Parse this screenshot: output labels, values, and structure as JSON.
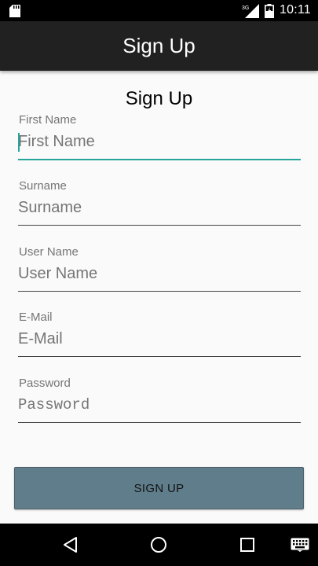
{
  "status_bar": {
    "network": "3G",
    "time": "10:11"
  },
  "app_bar": {
    "title": "Sign Up"
  },
  "form": {
    "heading": "Sign Up",
    "fields": [
      {
        "label": "First Name",
        "placeholder": "First Name",
        "value": "",
        "focused": true
      },
      {
        "label": "Surname",
        "placeholder": "Surname",
        "value": ""
      },
      {
        "label": "User Name",
        "placeholder": "User Name",
        "value": ""
      },
      {
        "label": "E-Mail",
        "placeholder": "E-Mail",
        "value": ""
      },
      {
        "label": "Password",
        "placeholder": "Password",
        "value": ""
      }
    ],
    "submit_label": "SIGN UP"
  },
  "colors": {
    "app_bar_bg": "#212121",
    "accent": "#26a69a",
    "button_bg": "#607d8b"
  },
  "nav_bar": {
    "icons": [
      "back-icon",
      "home-icon",
      "recents-icon",
      "keyboard-icon"
    ]
  }
}
